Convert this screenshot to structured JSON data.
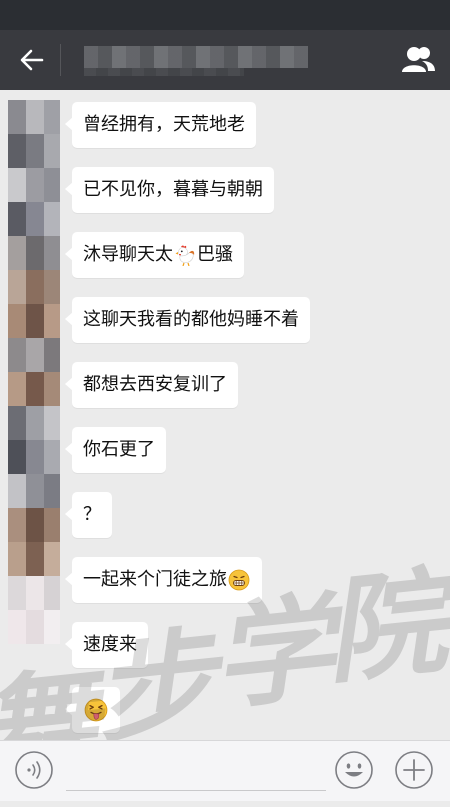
{
  "header": {
    "title": "",
    "back_icon": "arrow-left-icon",
    "contact_icon": "people-icon"
  },
  "messages": [
    {
      "text": "曾经拥有，天荒地老",
      "emoji": null
    },
    {
      "text": "已不见你，暮暮与朝朝",
      "emoji": null
    },
    {
      "text_before": "沐导聊天太",
      "emoji": "rooster",
      "text_after": "巴骚"
    },
    {
      "text": "这聊天我看的都他妈睡不着",
      "emoji": null
    },
    {
      "text": "都想去西安复训了",
      "emoji": null
    },
    {
      "text": "你石更了",
      "emoji": null
    },
    {
      "text": "？",
      "emoji": null
    },
    {
      "text_before": "一起来个门徒之旅",
      "emoji": "grimace-face",
      "text_after": ""
    },
    {
      "text": "速度来",
      "emoji": null
    },
    {
      "text_before": "",
      "emoji": "tongue-face",
      "text_after": ""
    }
  ],
  "watermark": {
    "chars": [
      "舞",
      "步",
      "学",
      "院"
    ]
  },
  "inputbar": {
    "voice_icon": "voice-icon",
    "emoji_icon": "smiley-icon",
    "plus_icon": "plus-icon"
  },
  "colors": {
    "header_bg": "#393a3f",
    "chat_bg": "#ebebeb",
    "bubble_bg": "#ffffff"
  }
}
